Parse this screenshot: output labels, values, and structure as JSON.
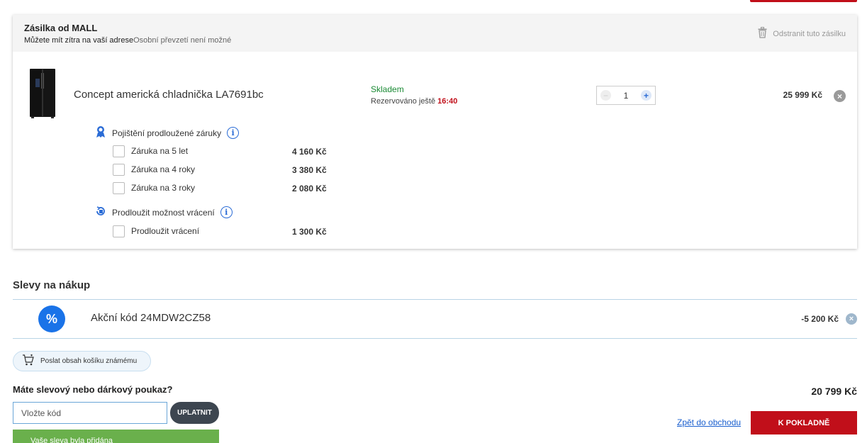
{
  "shipment": {
    "title": "Zásilka od MALL",
    "delivery": "Můžete mít zítra na vaší adrese",
    "pickup": "Osobní převzetí není možné",
    "remove_label": "Odstranit tuto zásilku"
  },
  "product": {
    "name": "Concept americká chladnička LA7691bc",
    "stock": "Skladem",
    "reserved_label": "Rezervováno ještě",
    "reserved_time": "16:40",
    "quantity": "1",
    "price": "25 999 Kč"
  },
  "warranty": {
    "title": "Pojištění prodloužené záruky",
    "options": [
      {
        "label": "Záruka na 5 let",
        "price": "4 160 Kč"
      },
      {
        "label": "Záruka na 4 roky",
        "price": "3 380 Kč"
      },
      {
        "label": "Záruka na 3 roky",
        "price": "2 080 Kč"
      }
    ]
  },
  "returns": {
    "title": "Prodloužit možnost vrácení",
    "options": [
      {
        "label": "Prodloužit vrácení",
        "price": "1 300 Kč"
      }
    ]
  },
  "discounts": {
    "title": "Slevy na nákup",
    "badge": "%",
    "items": [
      {
        "name": "Akční kód 24MDW2CZ58",
        "amount": "-5 200 Kč"
      }
    ]
  },
  "share_label": "Poslat obsah košíku známému",
  "voucher": {
    "question": "Máte slevový nebo dárkový poukaz?",
    "placeholder": "Vložte kód",
    "apply_label": "UPLATNIT",
    "success": "Vaše sleva byla přidána"
  },
  "total": "20 799 Kč",
  "back_link": "Zpět do obchodu",
  "checkout_label": "K POKLADNĚ",
  "colors": {
    "accent_red": "#c10f1a",
    "stock_green": "#1a8a34",
    "info_blue": "#2b6cd6",
    "success_green": "#6ab04c"
  }
}
